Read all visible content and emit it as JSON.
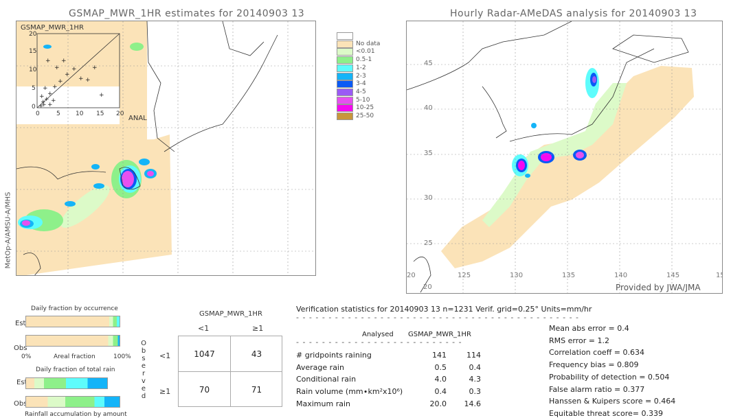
{
  "left_panel": {
    "title": "GSMAP_MWR_1HR estimates for 20140903 13",
    "side_label": "MetOp-A/AMSU-A/MHS",
    "inset": {
      "label": "GSMAP_MWR_1HR",
      "x_axis_label": "ANAL",
      "ticks": [
        "0",
        "5",
        "10",
        "15",
        "20"
      ]
    }
  },
  "right_panel": {
    "title": "Hourly Radar-AMeDAS analysis for 20140903 13",
    "credit": "Provided by JWA/JMA",
    "lat_ticks": [
      "45",
      "40",
      "35",
      "30",
      "25",
      "20"
    ],
    "lon_ticks": [
      "20",
      "125",
      "130",
      "135",
      "140",
      "145",
      "15"
    ]
  },
  "legend": {
    "items": [
      {
        "label": "",
        "color": "#ffffff"
      },
      {
        "label": "No data",
        "color": "#fbe3b8"
      },
      {
        "label": "<0.01",
        "color": "#dcfac8"
      },
      {
        "label": "0.5-1",
        "color": "#8ef08a"
      },
      {
        "label": "1-2",
        "color": "#5efcfc"
      },
      {
        "label": "2-3",
        "color": "#14b4f8"
      },
      {
        "label": "3-4",
        "color": "#0a5af5"
      },
      {
        "label": "4-5",
        "color": "#9a5af5"
      },
      {
        "label": "5-10",
        "color": "#e650f0"
      },
      {
        "label": "10-25",
        "color": "#f50af0"
      },
      {
        "label": "25-50",
        "color": "#c8963c"
      }
    ]
  },
  "occurrence_chart": {
    "title": "Daily fraction by occurrence",
    "est_label": "Est",
    "obs_label": "Obs",
    "x_left": "0%",
    "x_mid": "Areal fraction",
    "x_right": "100%"
  },
  "total_rain_chart": {
    "title": "Daily fraction of total rain",
    "est_label": "Est",
    "obs_label": "Obs",
    "footer": "Rainfall accumulation by amount"
  },
  "contingency": {
    "header": "GSMAP_MWR_1HR",
    "col_labels": [
      "<1",
      "≥1"
    ],
    "row_labels": [
      "<1",
      "≥1"
    ],
    "side_label": [
      "O",
      "b",
      "s",
      "e",
      "r",
      "v",
      "e",
      "d"
    ],
    "cells": [
      [
        "1047",
        "43"
      ],
      [
        "70",
        "71"
      ]
    ]
  },
  "verification": {
    "header": "Verification statistics for 20140903 13   n=1231   Verif. grid=0.25°   Units=mm/hr",
    "col_analysed": "Analysed",
    "col_gsmap": "GSMAP_MWR_1HR",
    "rows": [
      {
        "label": "# gridpoints raining",
        "analysed": "141",
        "gsmap": "114"
      },
      {
        "label": "Average rain",
        "analysed": "0.5",
        "gsmap": "0.4"
      },
      {
        "label": "Conditional rain",
        "analysed": "4.0",
        "gsmap": "4.3"
      },
      {
        "label": "Rain volume (mm∙km²x10⁶)",
        "analysed": "0.4",
        "gsmap": "0.3"
      },
      {
        "label": "Maximum rain",
        "analysed": "20.0",
        "gsmap": "14.6"
      }
    ],
    "scores": [
      "Mean abs error = 0.4",
      "RMS error = 1.2",
      "Correlation coeff = 0.634",
      "Frequency bias = 0.809",
      "Probability of detection = 0.504",
      "False alarm ratio = 0.377",
      "Hanssen & Kuipers score = 0.464",
      "Equitable threat score= 0.339"
    ]
  }
}
